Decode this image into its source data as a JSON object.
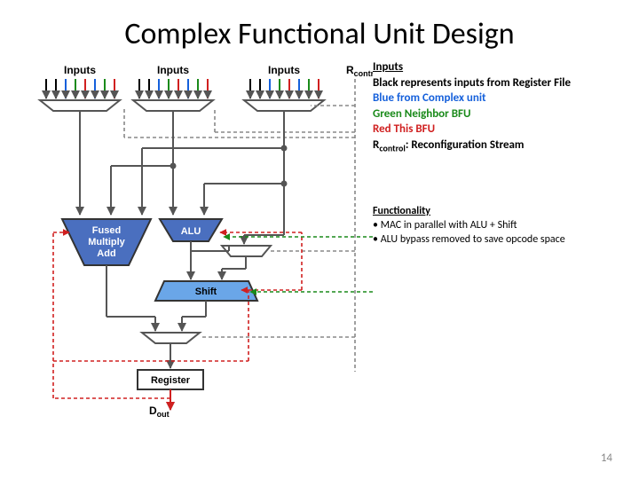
{
  "title": "Complex Functional Unit Design",
  "header": {
    "inputs1": "Inputs",
    "inputs2": "Inputs",
    "inputs3": "Inputs",
    "rcontrol": "R",
    "rcontrol_sub": "control"
  },
  "legend": {
    "heading": "Inputs",
    "black": "Black represents inputs from Register File",
    "blue": "Blue from Complex unit",
    "green": "Green Neighbor BFU",
    "red": "Red This BFU",
    "rcontrol_prefix": "R",
    "rcontrol_sub": "control",
    "rcontrol_rest": ": Reconfiguration Stream"
  },
  "functionality": {
    "heading": "Functionality",
    "bullet1": "• MAC in parallel with ALU + Shift",
    "bullet2": "• ALU bypass removed to save opcode space"
  },
  "blocks": {
    "fma1": "Fused",
    "fma2": "Multiply",
    "fma3": "Add",
    "alu": "ALU",
    "shift": "Shift",
    "register": "Register",
    "dout": "D",
    "dout_sub": "out"
  },
  "page_number": "14"
}
